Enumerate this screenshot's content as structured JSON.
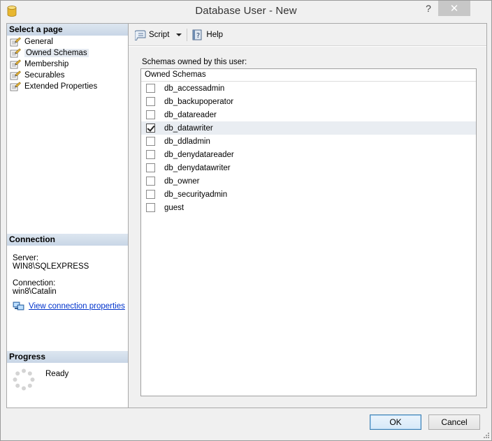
{
  "window": {
    "title": "Database User - New",
    "help_glyph": "?",
    "close_glyph": "✕"
  },
  "left": {
    "select_page_header": "Select a page",
    "nav_items": [
      {
        "label": "General",
        "selected": false
      },
      {
        "label": "Owned Schemas",
        "selected": true
      },
      {
        "label": "Membership",
        "selected": false
      },
      {
        "label": "Securables",
        "selected": false
      },
      {
        "label": "Extended Properties",
        "selected": false
      }
    ],
    "connection_header": "Connection",
    "server_label": "Server:",
    "server_value": "WIN8\\SQLEXPRESS",
    "connection_label": "Connection:",
    "connection_value": "win8\\Catalin",
    "view_connection_link": "View connection properties",
    "progress_header": "Progress",
    "progress_status": "Ready"
  },
  "toolbar": {
    "script_label": "Script",
    "help_label": "Help"
  },
  "main": {
    "caption": "Schemas owned by this user:",
    "grid_header": "Owned Schemas",
    "schemas": [
      {
        "name": "db_accessadmin",
        "checked": false
      },
      {
        "name": "db_backupoperator",
        "checked": false
      },
      {
        "name": "db_datareader",
        "checked": false
      },
      {
        "name": "db_datawriter",
        "checked": true
      },
      {
        "name": "db_ddladmin",
        "checked": false
      },
      {
        "name": "db_denydatareader",
        "checked": false
      },
      {
        "name": "db_denydatawriter",
        "checked": false
      },
      {
        "name": "db_owner",
        "checked": false
      },
      {
        "name": "db_securityadmin",
        "checked": false
      },
      {
        "name": "guest",
        "checked": false
      }
    ]
  },
  "buttons": {
    "ok_label": "OK",
    "cancel_label": "Cancel"
  },
  "colors": {
    "header_gradient_top": "#dde6f0",
    "header_gradient_bottom": "#c8d6e6",
    "link": "#0033cc",
    "close_button": "#c7c7c7"
  }
}
